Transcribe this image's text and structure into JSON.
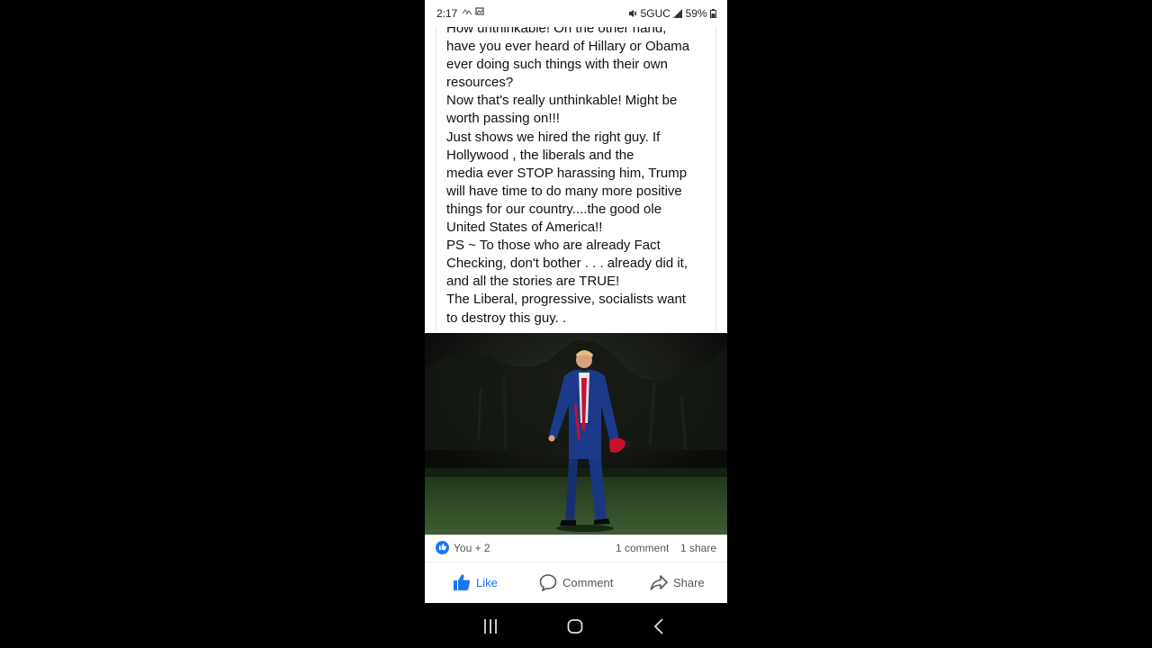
{
  "status_bar": {
    "time": "2:17",
    "network": "5GUC",
    "battery": "59%"
  },
  "post": {
    "text": "How unthinkable! On the other hand,\nhave you ever heard of Hillary or Obama\never doing such things with their own\nresources?\nNow that's really unthinkable! Might be\nworth passing on!!!\nJust shows we hired the right guy. If\nHollywood , the liberals and the\nmedia ever STOP harassing him, Trump\nwill have time to do many more positive\nthings for our country....the good ole\nUnited States of America!!\nPS ~ To those who are already Fact\nChecking, don't bother . . . already did it,\nand all the stories are TRUE!\nThe Liberal, progressive, socialists want\nto destroy this guy. ."
  },
  "reactions": {
    "reactors": "You + 2",
    "comments": "1 comment",
    "shares": "1 share"
  },
  "actions": {
    "like": "Like",
    "comment": "Comment",
    "share": "Share"
  },
  "colors": {
    "accent": "#1877f2",
    "suit": "#1c3a8a",
    "hat": "#c8102e",
    "grass": "#2f4a26"
  },
  "icons": {
    "like": "thumbs-up-icon",
    "comment": "speech-bubble-icon",
    "share": "share-arrow-icon",
    "nav_recents": "recent-apps-icon",
    "nav_home": "home-icon",
    "nav_back": "back-icon"
  }
}
